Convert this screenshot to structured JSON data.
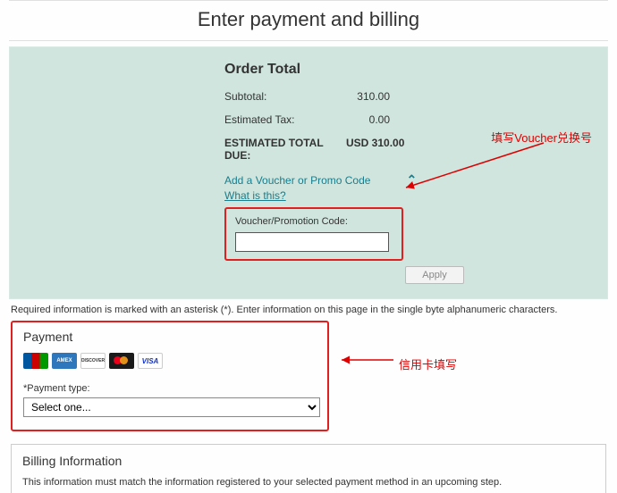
{
  "page": {
    "title": "Enter payment and billing"
  },
  "order": {
    "heading": "Order Total",
    "subtotal_label": "Subtotal:",
    "subtotal_value": "310.00",
    "tax_label": "Estimated Tax:",
    "tax_value": "0.00",
    "total_label": "ESTIMATED TOTAL DUE:",
    "total_value": "USD 310.00",
    "promo_link": "Add a Voucher or Promo Code",
    "promo_help": "What is this?",
    "voucher_label": "Voucher/Promotion Code:",
    "voucher_value": "",
    "apply_label": "Apply"
  },
  "info_note": "Required information is marked with an asterisk (*). Enter information on this page in the single byte alphanumeric characters.",
  "payment": {
    "heading": "Payment",
    "cards": [
      "jcb",
      "amex",
      "discover",
      "mastercard",
      "visa"
    ],
    "ptype_label": "*Payment type:",
    "ptype_selected": "Select one..."
  },
  "billing": {
    "heading": "Billing Information",
    "note": "This information must match the information registered to your selected payment method in an upcoming step."
  },
  "annotations": {
    "voucher_hint": "填写Voucher兑换号",
    "creditcard_hint": "信用卡填写"
  },
  "colors": {
    "highlight_border": "#e02020",
    "link": "#1a7d8b"
  }
}
